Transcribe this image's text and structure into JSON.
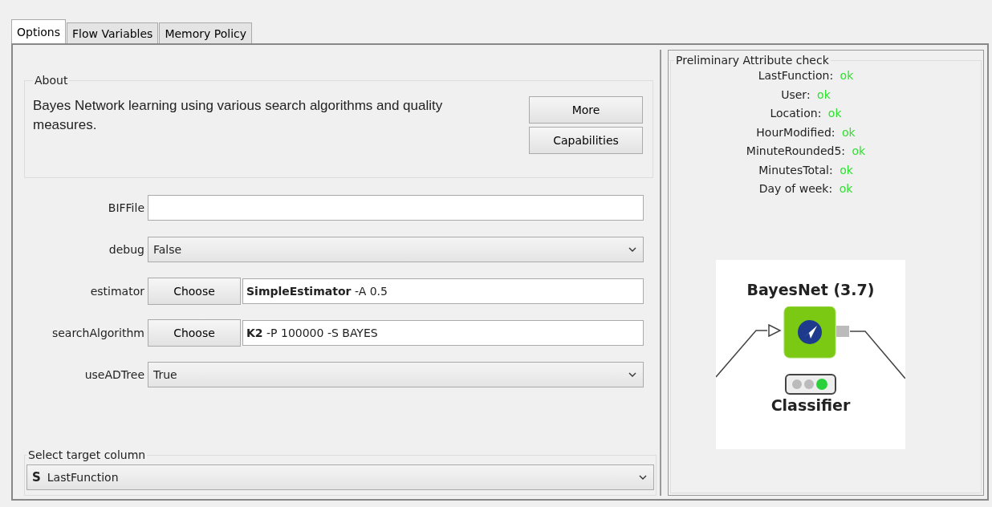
{
  "tabs": [
    {
      "label": "Options",
      "selected": true
    },
    {
      "label": "Flow Variables",
      "selected": false
    },
    {
      "label": "Memory Policy",
      "selected": false
    }
  ],
  "about": {
    "title": "About",
    "description": "Bayes Network learning using various search algorithms and quality measures.",
    "buttons": [
      "More",
      "Capabilities"
    ]
  },
  "parameters": [
    {
      "kind": "text",
      "label": "BIFFile"
    },
    {
      "kind": "dropdown",
      "label": "debug",
      "value": "False"
    },
    {
      "kind": "chooser",
      "label": "estimator",
      "button": "Choose",
      "value": "**SimpleEstimator** -A 0.5"
    },
    {
      "kind": "chooser",
      "label": "searchAlgorithm",
      "button": "Choose",
      "value": "**K2** -P 100000 -S BAYES"
    },
    {
      "kind": "dropdown",
      "label": "useADTree",
      "value": "True"
    }
  ],
  "target_column": {
    "title": "Select target column",
    "type_badge": "S",
    "value": "LastFunction"
  },
  "attribute_check": {
    "title": "Preliminary Attribute check",
    "items": [
      {
        "name": "LastFunction:",
        "status": "ok"
      },
      {
        "name": "User:",
        "status": "ok"
      },
      {
        "name": "Location:",
        "status": "ok"
      },
      {
        "name": "HourModified:",
        "status": "ok"
      },
      {
        "name": "MinuteRounded5:",
        "status": "ok"
      },
      {
        "name": "MinutesTotal:",
        "status": "ok"
      },
      {
        "name": "Day of week:",
        "status": "ok"
      }
    ]
  },
  "node": {
    "title": "BayesNet (3.7)",
    "label": "Classifier"
  }
}
